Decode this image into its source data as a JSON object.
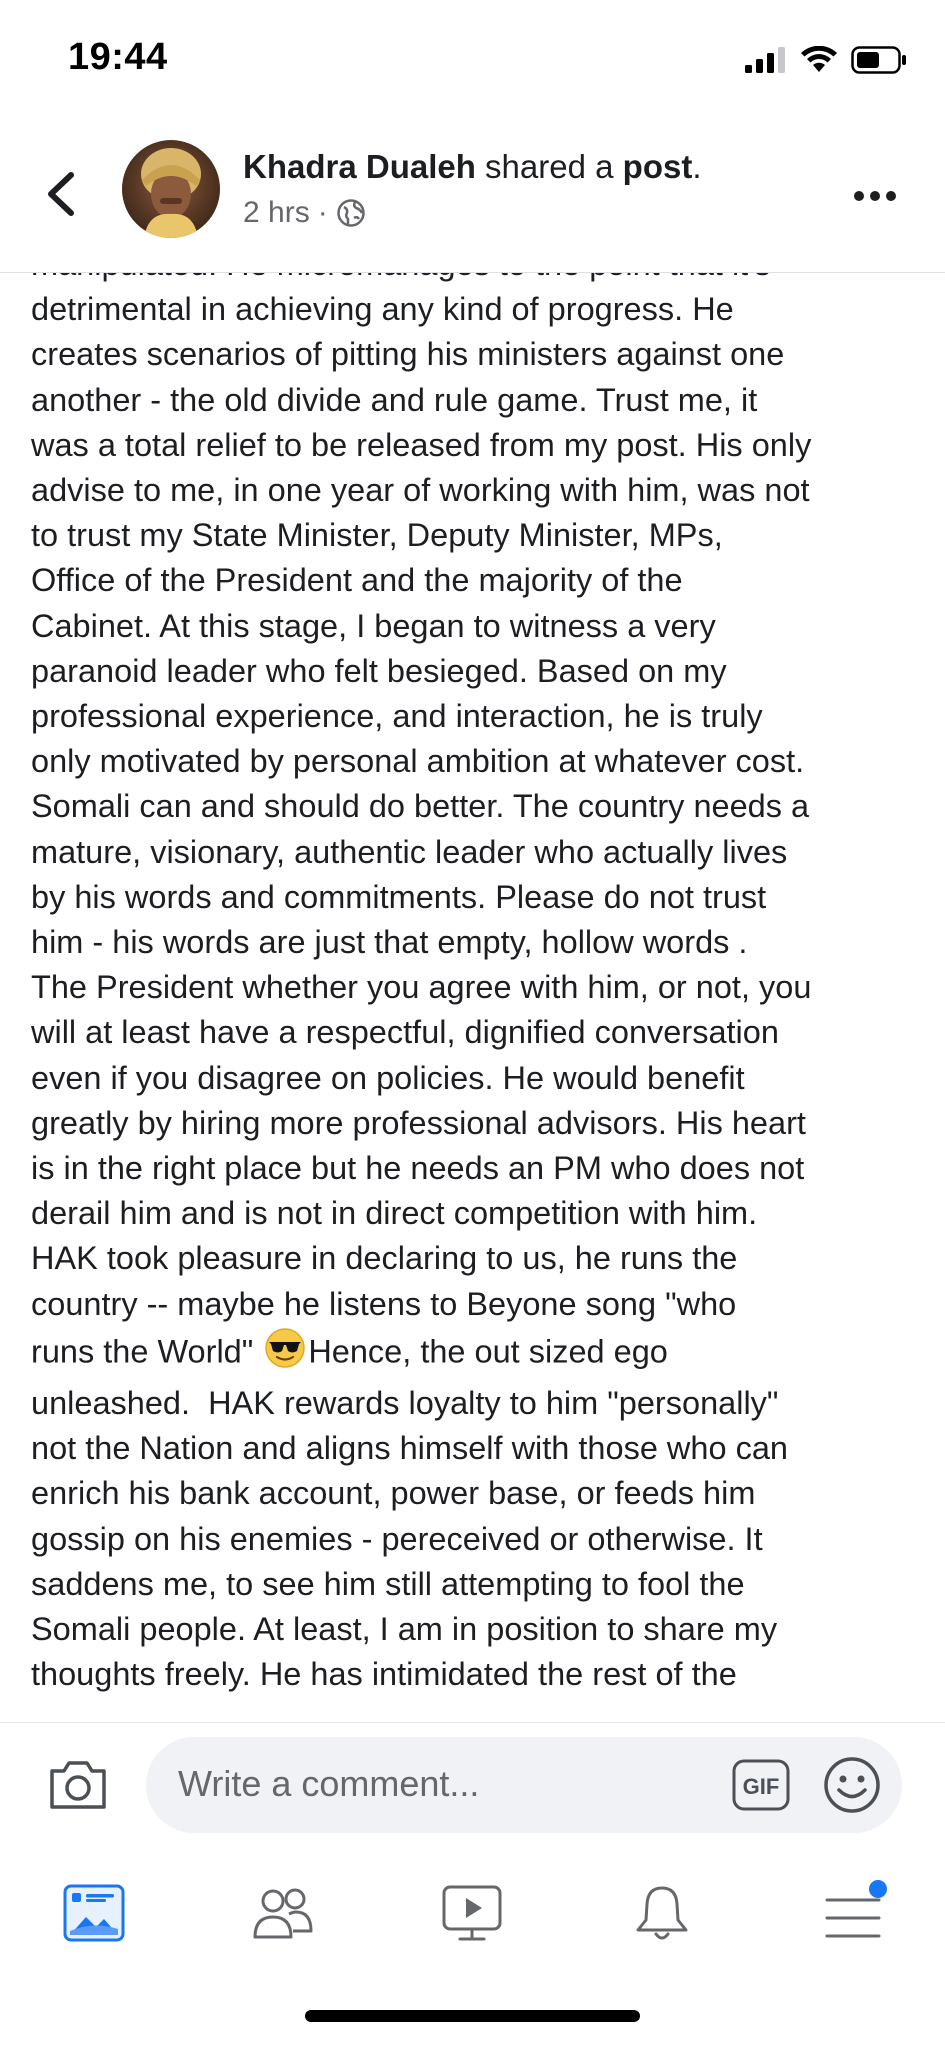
{
  "status_bar": {
    "time": "19:44",
    "icons": [
      "signal-icon",
      "wifi-icon",
      "battery-icon"
    ]
  },
  "header": {
    "poster_name": "Khadra Dualeh",
    "action_text": " shared a ",
    "object_text": "post",
    "punctuation": ".",
    "timestamp": "2 hrs",
    "separator": " · ",
    "privacy_icon": "globe-icon"
  },
  "post": {
    "lines_before_emoji": "manipulated. He micromanages to the point that it's\ndetrimental in achieving any kind of progress. He\ncreates scenarios of pitting his ministers against one\nanother - the old divide and rule game. Trust me, it\nwas a total relief to be released from my post. His only\nadvise to me, in one year of working with him, was not\nto trust my State Minister, Deputy Minister, MPs,\nOffice of the President and the majority of the\nCabinet. At this stage, I began to witness a very\nparanoid leader who felt besieged. Based on my\nprofessional experience, and interaction, he is truly\nonly motivated by personal ambition at whatever cost.\nSomali can and should do better. The country needs a\nmature, visionary, authentic leader who actually lives\nby his words and commitments. Please do not trust\nhim - his words are just that empty, hollow words .\nThe President whether you agree with him, or not, you\nwill at least have a respectful, dignified conversation\neven if you disagree on policies. He would benefit\ngreatly by hiring more professional advisors. His heart\nis in the right place but he needs an PM who does not\nderail him and is not in direct competition with him.\nHAK took pleasure in declaring to us, he runs the\ncountry -- maybe he listens to Beyone song \"who\nruns the World\" ",
    "emoji": "sunglasses-emoji",
    "lines_after_emoji": "Hence, the out sized ego\nunleashed.  HAK rewards loyalty to him \"personally\"\nnot the Nation and aligns himself with those who can\nenrich his bank account, power base, or feeds him\ngossip on his enemies - pereceived or otherwise. It\nsaddens me, to see him still attempting to fool the\nSomali people. At least, I am in position to share my\nthoughts freely. He has intimidated the rest of the"
  },
  "comment_bar": {
    "placeholder": "Write a comment...",
    "gif_label": "GIF"
  },
  "bottom_nav": {
    "items": [
      "news-feed-icon",
      "friends-icon",
      "watch-icon",
      "notifications-icon",
      "menu-icon"
    ],
    "menu_badge_color": "#1877f2",
    "active_color": "#1877f2"
  }
}
